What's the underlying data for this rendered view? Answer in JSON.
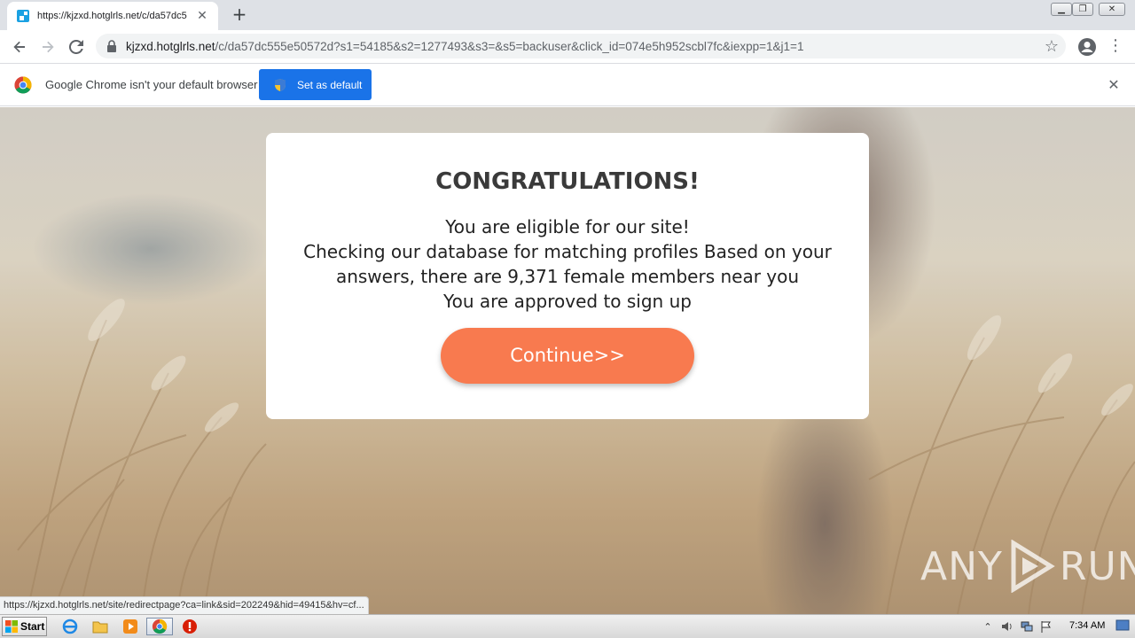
{
  "browser": {
    "tab_title": "https://kjzxd.hotglrls.net/c/da57dc5",
    "url_host": "kjzxd.hotglrls.net",
    "url_path": "/c/da57dc555e50572d?s1=54185&s2=1277493&s3=&s5=backuser&click_id=074e5h952scbl7fc&iexpp=1&j1=1",
    "icons": {
      "back": "arrow-left-icon",
      "forward": "arrow-right-icon",
      "reload": "reload-icon",
      "bookmark": "star-icon",
      "profile": "account-icon",
      "menu": "kebab-menu-icon",
      "secure": "lock-icon"
    }
  },
  "infobar": {
    "message": "Google Chrome isn't your default browser",
    "button_label": "Set as default",
    "close_glyph": "✕"
  },
  "modal": {
    "title": "CONGRATULATIONS!",
    "line1": "You are eligible for our site!",
    "line2": "Checking our database for matching profiles Based on your answers, there are 9,371 female members near you",
    "line3": "You are approved to sign up",
    "button_label": "Continue>>"
  },
  "watermark": {
    "left": "ANY",
    "right": "RUN"
  },
  "status_url": "https://kjzxd.hotglrls.net/site/redirectpage?ca=link&sid=202249&hid=49415&hv=cf...",
  "taskbar": {
    "start_label": "Start",
    "clock": "7:34 AM"
  },
  "colors": {
    "accent": "#1a73e8",
    "continue_button": "#f87a4f"
  }
}
